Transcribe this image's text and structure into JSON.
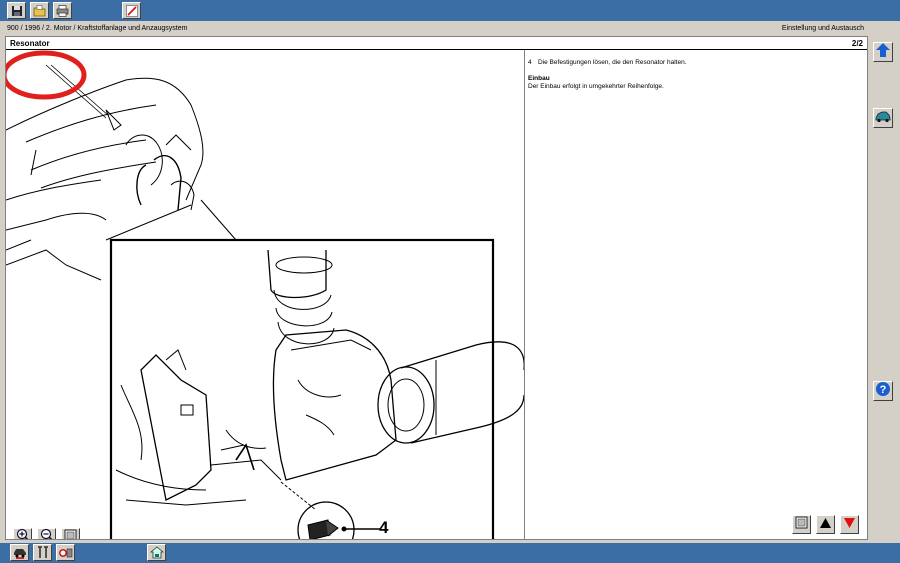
{
  "toolbar": {
    "icons": [
      "save-icon",
      "open-folder-icon",
      "print-icon",
      "edit-icon"
    ]
  },
  "header": {
    "breadcrumb": "900 / 1996 / 2. Motor / Kraftstoffanlage und Anzaugsystem",
    "category": "Einstellung und Austausch"
  },
  "document": {
    "title": "Resonator",
    "page": "2/2",
    "step_number": "4",
    "step_text": "Die Befestigungen lösen, die den Resonator halten.",
    "section_heading": "Einbau",
    "section_text": "Der Einbau erfolgt in umgekehrter Reihenfolge."
  },
  "figure": {
    "id": "D232R016",
    "callout": "4"
  },
  "colors": {
    "desktop": "#3a6ea5",
    "chrome": "#d4d0c8",
    "highlight_circle": "#e0201c",
    "arrow_up": "#1a5fd0",
    "arrow_down": "#e01010"
  },
  "bottom": {
    "icons": [
      "car-icon",
      "tools-icon",
      "diagnostic-icon",
      "home-car-icon"
    ]
  }
}
